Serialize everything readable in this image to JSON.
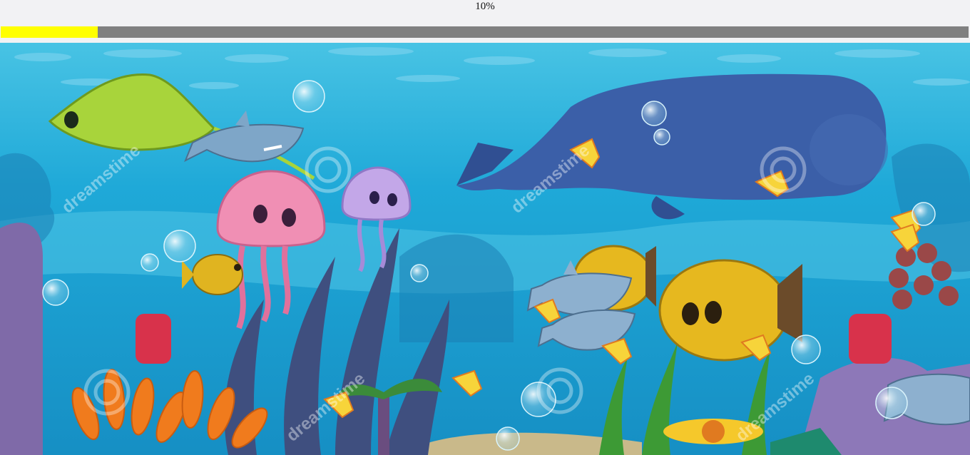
{
  "hud": {
    "progress_label": "10%",
    "progress_fraction": 0.1,
    "progress_color": "#ffff00",
    "track_color": "#808080"
  },
  "scene": {
    "watermark": "dreamstime"
  }
}
